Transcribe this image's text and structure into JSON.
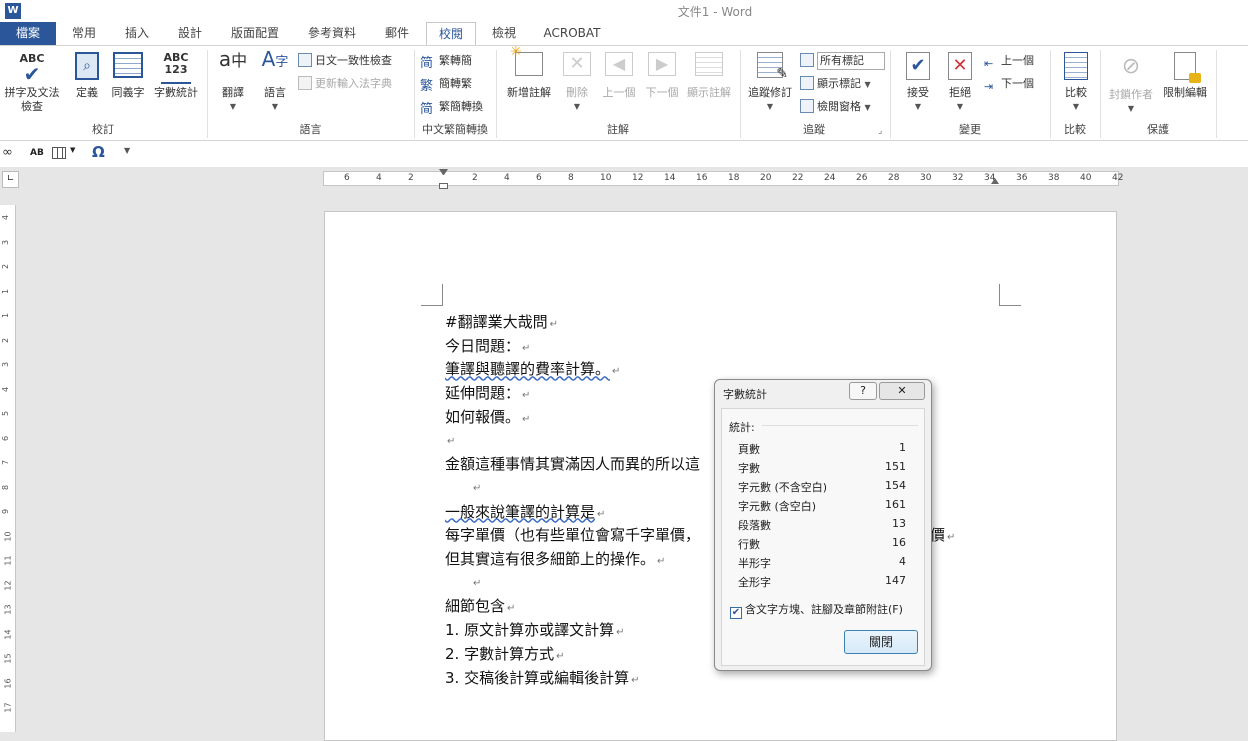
{
  "window": {
    "title": "文件1 - Word",
    "app_icon": "W"
  },
  "tabs": [
    {
      "label": "檔案"
    },
    {
      "label": "常用"
    },
    {
      "label": "插入"
    },
    {
      "label": "設計"
    },
    {
      "label": "版面配置"
    },
    {
      "label": "參考資料"
    },
    {
      "label": "郵件"
    },
    {
      "label": "校閱"
    },
    {
      "label": "檢視"
    },
    {
      "label": "ACROBAT"
    }
  ],
  "active_tab": "校閱",
  "ribbon": {
    "proofing": {
      "group": "校訂",
      "spelling": "拼字及文法",
      "spelling2": "檢查",
      "spelling_icon_text": "ABC",
      "define": "定義",
      "thesaurus": "同義字",
      "wordcount": "字數統計",
      "wordcount_icon_text": "ABC\n123"
    },
    "language": {
      "group": "語言",
      "translate": "翻譯",
      "language": "語言",
      "consistency": "日文一致性檢查",
      "update_ime": "更新輸入法字典"
    },
    "chinese": {
      "group": "中文繁簡轉換",
      "t2s": "繁轉簡",
      "s2t": "簡轉繁",
      "convert": "繁簡轉換"
    },
    "comments": {
      "group": "註解",
      "new": "新增註解",
      "delete": "刪除",
      "prev": "上一個",
      "next": "下一個",
      "show": "顯示註解"
    },
    "tracking": {
      "group": "追蹤",
      "track": "追蹤修訂",
      "markup_select": "所有標記",
      "show_markup": "顯示標記",
      "pane": "檢閱窗格"
    },
    "changes": {
      "group": "變更",
      "accept": "接受",
      "reject": "拒絕",
      "prev": "上一個",
      "next": "下一個"
    },
    "compare": {
      "group": "比較",
      "compare": "比較"
    },
    "protect": {
      "group": "保護",
      "block": "封鎖作者",
      "restrict": "限制編輯"
    }
  },
  "qat": {
    "ab_label": "AB",
    "omega": "Ω"
  },
  "ruler": {
    "ticks": [
      "6",
      "4",
      "2",
      "2",
      "4",
      "6",
      "8",
      "10",
      "12",
      "14",
      "16",
      "18",
      "20",
      "22",
      "24",
      "26",
      "28",
      "30",
      "32",
      "34",
      "36",
      "38",
      "40",
      "42"
    ],
    "vticks": [
      "4",
      "3",
      "2",
      "1",
      "1",
      "2",
      "3",
      "4",
      "5",
      "6",
      "7",
      "8",
      "9",
      "10",
      "11",
      "12",
      "13",
      "14",
      "15",
      "16",
      "17"
    ]
  },
  "document": {
    "lines": [
      "#翻譯業大哉問",
      "今日問題：",
      "筆譯與聽譯的費率計算。",
      "延伸問題：",
      "如何報價。",
      "",
      "金額這種事情其實滿因人而異的所以這",
      "",
      "一般來說筆譯的計算是",
      "每字單價（也有些單位會寫千字單價，",
      "但其實這有很多細節上的操作。",
      "",
      "細節包含",
      "1.  原文計算亦或譯文計算",
      "2.  字數計算方式",
      "3.  交稿後計算或編輯後計算"
    ],
    "line12_tail": "價"
  },
  "dialog": {
    "title": "字數統計",
    "help": "?",
    "close_x": "✕",
    "stats_label": "統計:",
    "rows": [
      {
        "label": "頁數",
        "value": "1"
      },
      {
        "label": "字數",
        "value": "151"
      },
      {
        "label": "字元數 (不含空白)",
        "value": "154"
      },
      {
        "label": "字元數 (含空白)",
        "value": "161"
      },
      {
        "label": "段落數",
        "value": "13"
      },
      {
        "label": "行數",
        "value": "16"
      },
      {
        "label": "半形字",
        "value": "4"
      },
      {
        "label": "全形字",
        "value": "147"
      }
    ],
    "checkbox_label": "含文字方塊、註腳及章節附註(F)",
    "checkbox_checked": true,
    "close_button": "關閉"
  },
  "colors": {
    "accent": "#2b579a"
  }
}
